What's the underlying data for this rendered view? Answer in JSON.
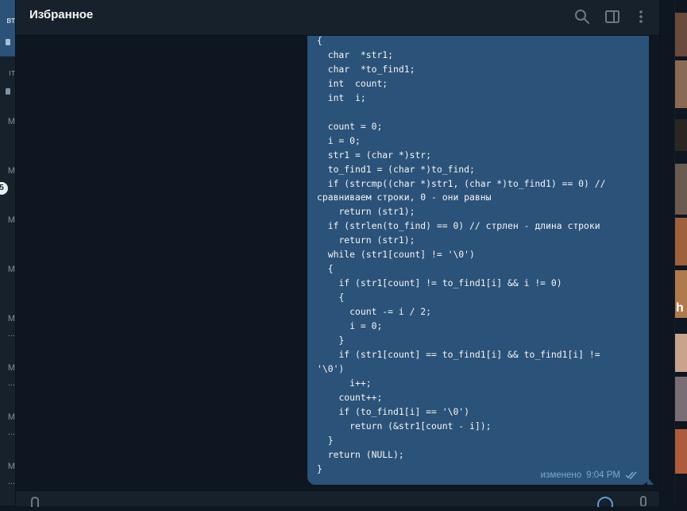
{
  "header": {
    "title": "Избранное",
    "search_icon": "search-icon",
    "sidebar_icon": "sidebar-toggle-icon",
    "menu_icon": "more-vertical-icon"
  },
  "left_list": {
    "fragments": [
      {
        "text": "вт"
      },
      {
        "text": "ıт"
      },
      {
        "text": "M"
      },
      {
        "text": "M"
      },
      {
        "text": "M"
      },
      {
        "text": "M"
      },
      {
        "text": "M"
      },
      {
        "text": "..."
      },
      {
        "text": "M"
      },
      {
        "text": "..."
      },
      {
        "text": "M"
      },
      {
        "text": "..."
      },
      {
        "text": "M"
      },
      {
        "text": "..."
      }
    ],
    "badge": "5"
  },
  "message": {
    "code": "{\n  char  *str1;\n  char  *to_find1;\n  int  count;\n  int  i;\n\n  count = 0;\n  i = 0;\n  str1 = (char *)str;\n  to_find1 = (char *)to_find;\n  if (strcmp((char *)str1, (char *)to_find1) == 0) //\nсравниваем строки, 0 - они равны\n    return (str1);\n  if (strlen(to_find) == 0) // стрлен - длина строки\n    return (str1);\n  while (str1[count] != '\\0')\n  {\n    if (str1[count] != to_find1[i] && i != 0)\n    {\n      count -= i / 2;\n      i = 0;\n    }\n    if (str1[count] == to_find1[i] && to_find1[i] !=\n'\\0')\n      i++;\n    count++;\n    if (to_find1[i] == '\\0')\n      return (&str1[count - i]);\n  }\n  return (NULL);\n}",
    "edited_label": "изменено",
    "time": "9:04 PM",
    "status_icon": "double-check-icon"
  },
  "bottom_bar": {
    "attach_icon": "paperclip-icon",
    "emoji_icon": "emoji-icon",
    "mic_icon": "microphone-icon"
  },
  "colors": {
    "background": "#0e1621",
    "panel": "#17212b",
    "bubble": "#2b5278",
    "meta_text": "#7da8d3"
  },
  "right_strip": {
    "letter": "h"
  }
}
